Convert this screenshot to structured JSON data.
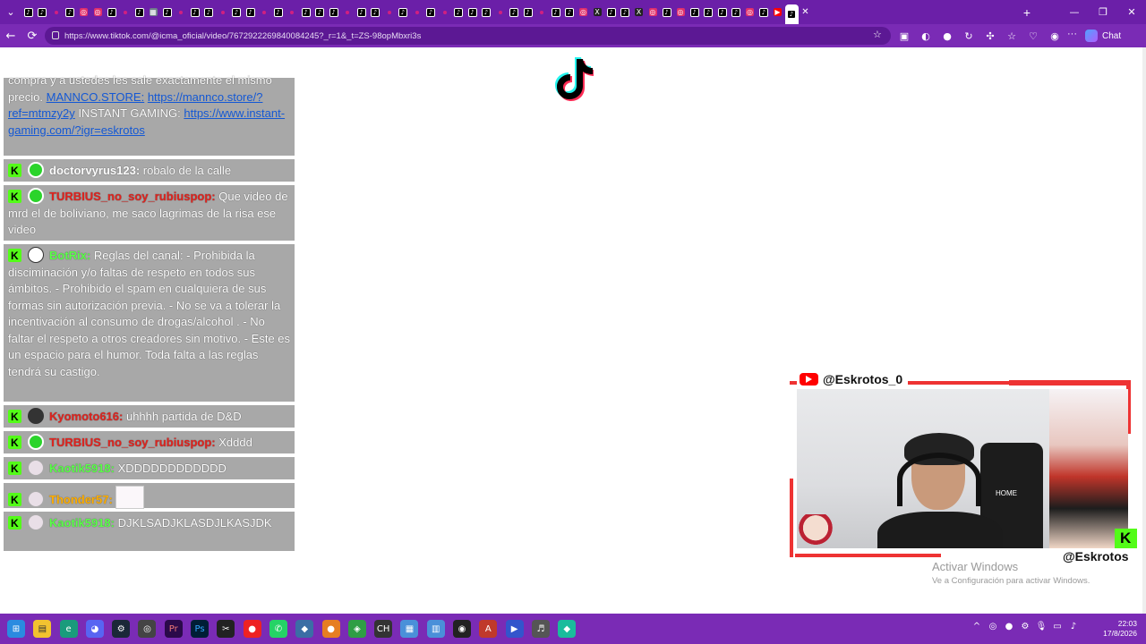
{
  "browser": {
    "url": "https://www.tiktok.com/@icma_oficial/video/7672922269840084245?_r=1&_t=ZS-98opMbxri3s",
    "chat_label": "Chat",
    "tab_favicons": [
      "tt",
      "tt",
      "dot",
      "tt",
      "ig",
      "ig",
      "tt",
      "dot",
      "tt",
      "gray",
      "tt",
      "dot",
      "tt",
      "tt",
      "dot",
      "tt",
      "tt",
      "dot",
      "tt",
      "dot",
      "tt",
      "tt",
      "tt",
      "dot",
      "tt",
      "tt",
      "dot",
      "tt",
      "dot",
      "tt",
      "dot",
      "tt",
      "tt",
      "tt",
      "dot",
      "tt",
      "tt",
      "dot",
      "tt",
      "tt",
      "ig",
      "x",
      "tt",
      "tt",
      "x",
      "ig",
      "tt",
      "ig",
      "tt",
      "tt",
      "tt",
      "tt",
      "ig",
      "tt",
      "yt",
      "tt"
    ]
  },
  "chat": {
    "messages": [
      {
        "id": "m0",
        "pre_text": "compra y a ustedes les sale exactamente el mismo precio. ",
        "link1": "MANNCO.STORE:",
        "sp1": " ",
        "link2": "https://mannco.store/?ref=mtmzy2y",
        "mid": " INSTANT GAMING: ",
        "link3": "https://www.instant-gaming.com/?igr=eskrotos"
      },
      {
        "id": "m1",
        "user": "doctorvyrus123:",
        "text": " robalo de la calle",
        "color": "white",
        "avatar": "green"
      },
      {
        "id": "m2",
        "user": "TURBIUS_no_soy_rubiuspop:",
        "text": " Que video de mrd el de boliviano, me saco lagrimas de la risa ese video",
        "color": "red",
        "avatar": "green"
      },
      {
        "id": "m3",
        "user": "BotRix:",
        "text": " Reglas del canal: - Prohibida la disciminación y/o faltas de respeto en todos sus ámbitos. - Prohibido el spam en cualquiera de sus formas sin autorización previa. - No se va a tolerar la incentivación al consumo de drogas/alcohol . - No faltar el respeto a otros creadores sin motivo. - Este es un espacio para el humor. Toda falta a las reglas tendrá su castigo.",
        "color": "green",
        "avatar": "botrix"
      },
      {
        "id": "m4",
        "user": "Kyomoto616:",
        "text": " uhhhh partida de D&D",
        "color": "red",
        "avatar": "dark"
      },
      {
        "id": "m5",
        "user": "TURBIUS_no_soy_rubiuspop:",
        "text": " Xdddd",
        "color": "red",
        "avatar": "green"
      },
      {
        "id": "m6",
        "user": "Kaotik5918:",
        "text": " XDDDDDDDDDDDD",
        "color": "green",
        "avatar": "anime"
      },
      {
        "id": "m7",
        "user": "Thonder57:",
        "text": " ",
        "color": "orange",
        "avatar": "anime",
        "emote": true
      },
      {
        "id": "m8",
        "user": "Kaotik5918:",
        "text": " DJKLSADJKLASDJLKASJDK",
        "color": "green",
        "avatar": "anime"
      }
    ]
  },
  "webcam": {
    "youtube_handle": "@Eskrotos_0",
    "kick_handle": "@Eskrotos",
    "chair_text": "HOME"
  },
  "watermark": {
    "title": "Activar Windows",
    "subtitle": "Ve a Configuración para activar Windows."
  },
  "taskbar": {
    "time": "22:03",
    "date": "17/8/2026"
  },
  "colors": {
    "browser_chrome": "#7a2bb5",
    "chat_bg": "#a8a8a8",
    "kick_green": "#53fc18",
    "accent_red": "#e33333"
  }
}
